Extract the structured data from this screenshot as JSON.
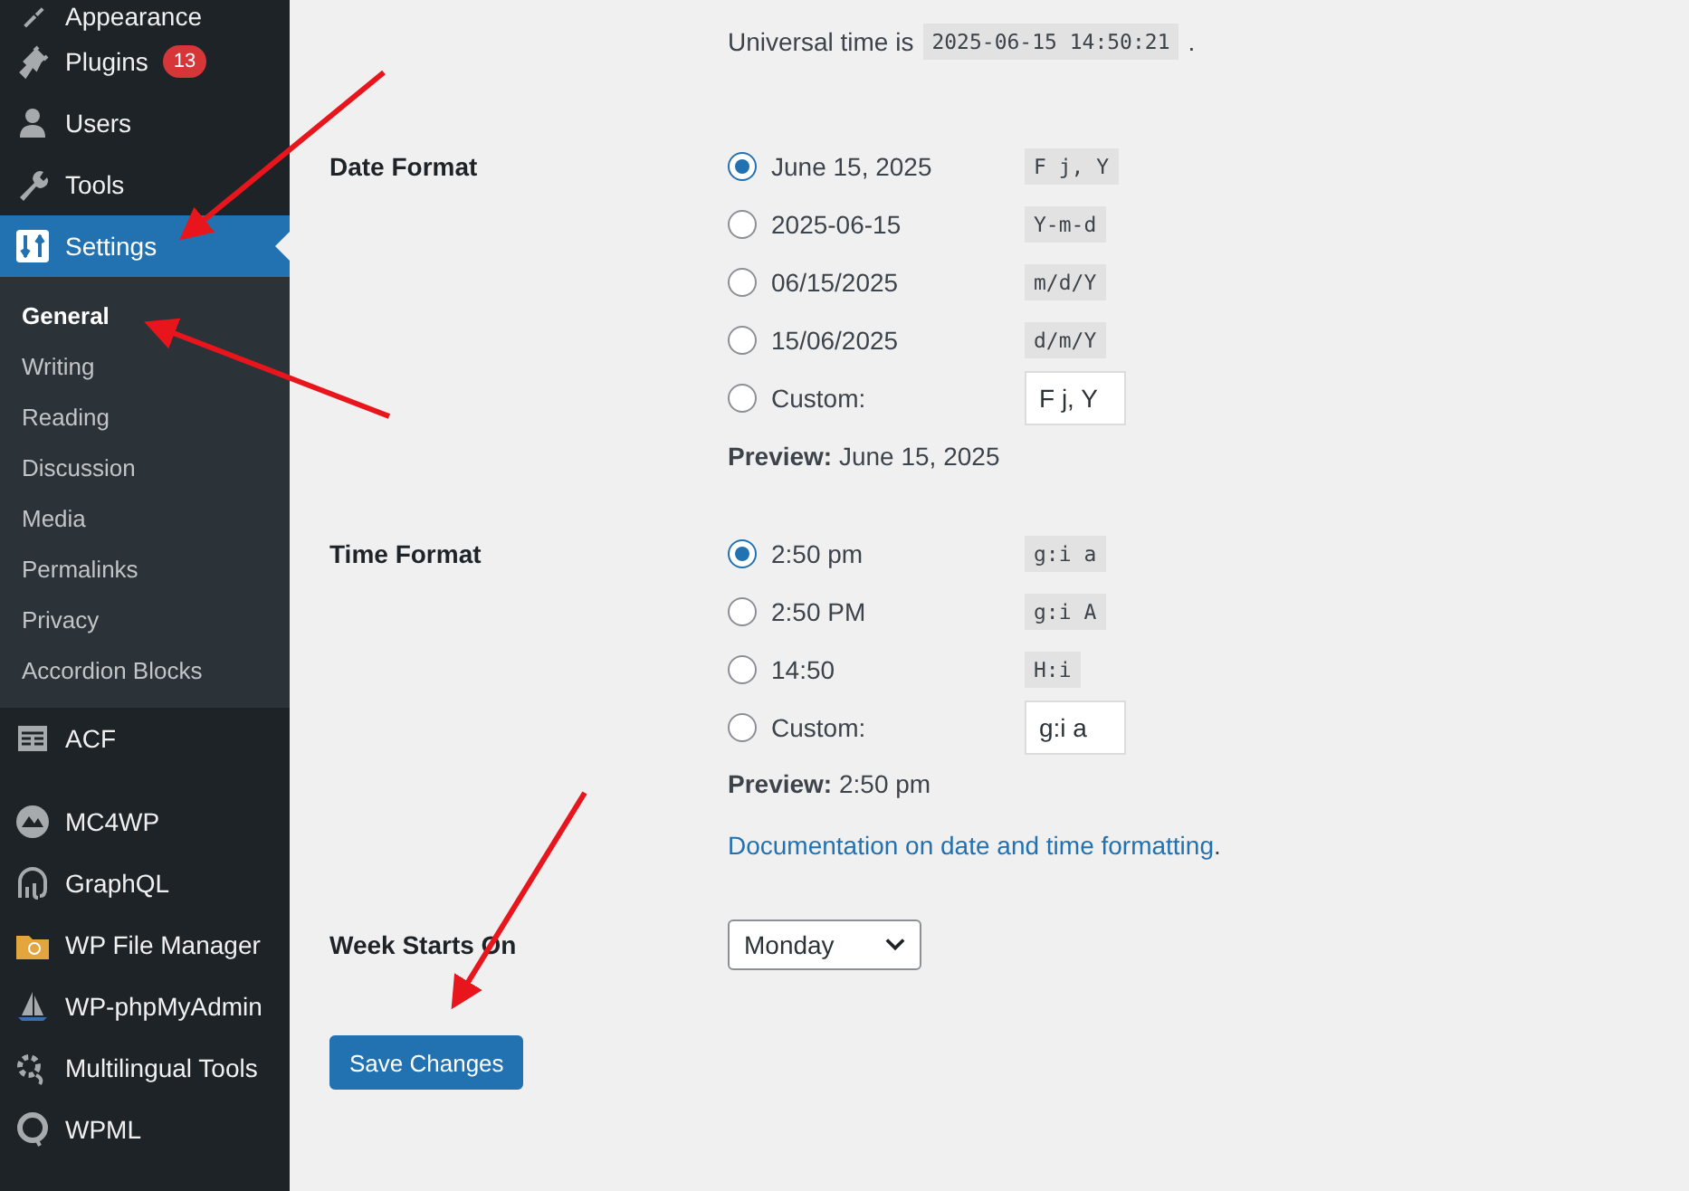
{
  "sidebar": {
    "groups": [
      {
        "items": [
          {
            "label": "Appearance",
            "selected": false
          },
          {
            "label": "Plugins",
            "badge": "13",
            "selected": false
          },
          {
            "label": "Users",
            "selected": false
          },
          {
            "label": "Tools",
            "selected": false
          },
          {
            "label": "Settings",
            "selected": true,
            "submenu": [
              {
                "label": "General",
                "selected": true
              },
              {
                "label": "Writing",
                "selected": false
              },
              {
                "label": "Reading",
                "selected": false
              },
              {
                "label": "Discussion",
                "selected": false
              },
              {
                "label": "Media",
                "selected": false
              },
              {
                "label": "Permalinks",
                "selected": false
              },
              {
                "label": "Privacy",
                "selected": false
              },
              {
                "label": "Accordion Blocks",
                "selected": false
              }
            ]
          },
          {
            "label": "ACF",
            "selected": false
          }
        ]
      },
      {
        "items": [
          {
            "label": "MC4WP",
            "selected": false
          },
          {
            "label": "GraphQL",
            "selected": false
          },
          {
            "label": "WP File Manager",
            "selected": false
          },
          {
            "label": "WP-phpMyAdmin",
            "selected": false
          },
          {
            "label": "Multilingual Tools",
            "selected": false
          },
          {
            "label": "WPML",
            "selected": false
          }
        ]
      }
    ]
  },
  "universal_time": {
    "label": "Universal time is",
    "value": "2025-06-15 14:50:21",
    "suffix": "."
  },
  "date_format": {
    "label": "Date Format",
    "options": [
      {
        "kind": "preset",
        "label": "June 15, 2025",
        "code": "F j, Y",
        "selected": true
      },
      {
        "kind": "preset",
        "label": "2025-06-15",
        "code": "Y-m-d",
        "selected": false
      },
      {
        "kind": "preset",
        "label": "06/15/2025",
        "code": "m/d/Y",
        "selected": false
      },
      {
        "kind": "preset",
        "label": "15/06/2025",
        "code": "d/m/Y",
        "selected": false
      },
      {
        "kind": "custom",
        "label": "Custom:",
        "value": "F j, Y",
        "selected": false
      }
    ],
    "preview": "**Preview:** June 15, 2025"
  },
  "time_format": {
    "label": "Time Format",
    "options": [
      {
        "kind": "preset",
        "label": "2:50 pm",
        "code": "g:i a",
        "selected": true
      },
      {
        "kind": "preset",
        "label": "2:50 PM",
        "code": "g:i A",
        "selected": false
      },
      {
        "kind": "preset",
        "label": "14:50",
        "code": "H:i",
        "selected": false
      },
      {
        "kind": "custom",
        "label": "Custom:",
        "value": "g:i a",
        "selected": false
      }
    ],
    "preview": "**Preview:** 2:50 pm",
    "doc_link": "Documentation on date and time formatting",
    "doc_suffix": "."
  },
  "week_starts_on": {
    "label": "Week Starts On",
    "value": "Monday"
  },
  "save_button": "Save Changes"
}
